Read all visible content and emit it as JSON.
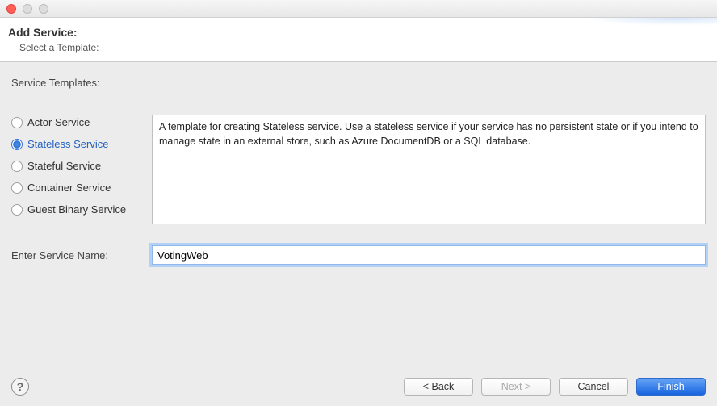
{
  "window": {
    "title": "Add Service:",
    "subtitle": "Select a Template:"
  },
  "section_label": "Service Templates:",
  "templates": [
    {
      "label": "Actor Service",
      "selected": false
    },
    {
      "label": "Stateless Service",
      "selected": true
    },
    {
      "label": "Stateful Service",
      "selected": false
    },
    {
      "label": "Container Service",
      "selected": false
    },
    {
      "label": "Guest Binary Service",
      "selected": false
    }
  ],
  "description": "A template for creating Stateless service.  Use a stateless service if your service has no persistent state or if you intend to manage state in an external store, such as Azure DocumentDB or a SQL database.",
  "name_field": {
    "label": "Enter Service Name:",
    "value": "VotingWeb"
  },
  "buttons": {
    "back": "< Back",
    "next": "Next >",
    "cancel": "Cancel",
    "finish": "Finish"
  },
  "help_glyph": "?"
}
